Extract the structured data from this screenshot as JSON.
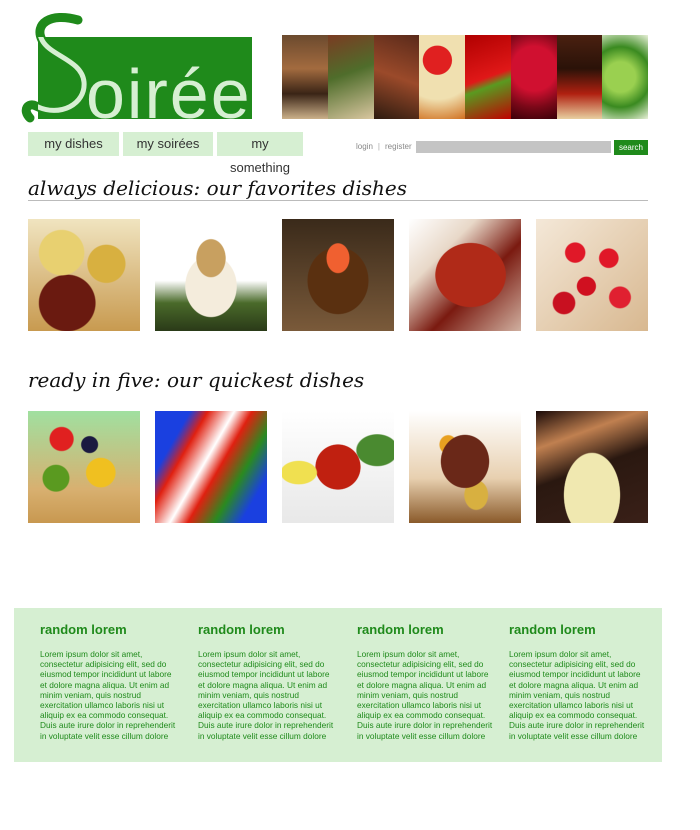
{
  "brand": {
    "name": "Soirée",
    "primary": "#1f8a1b",
    "pale": "#d6efd2"
  },
  "nav": {
    "items": [
      "my dishes",
      "my soirées",
      "my something"
    ]
  },
  "auth": {
    "login": "login",
    "separator": "|",
    "register": "register"
  },
  "search": {
    "placeholder": "",
    "button": "search"
  },
  "sections": [
    {
      "title": "always delicious: our favorites dishes"
    },
    {
      "title": "ready in five: our quickest dishes"
    }
  ],
  "footer": {
    "columns": [
      {
        "heading": "random lorem",
        "body": "Lorem ipsum dolor sit amet, consectetur adipisicing elit, sed do eiusmod tempor incididunt ut labore et dolore magna aliqua. Ut enim ad minim veniam, quis nostrud exercitation ullamco laboris nisi ut aliquip ex ea commodo consequat. Duis aute irure dolor in reprehenderit in voluptate velit esse cillum dolore"
      },
      {
        "heading": "random lorem",
        "body": "Lorem ipsum dolor sit amet, consectetur adipisicing elit, sed do eiusmod tempor incididunt ut labore et dolore magna aliqua. Ut enim ad minim veniam, quis nostrud exercitation ullamco laboris nisi ut aliquip ex ea commodo consequat. Duis aute irure dolor in reprehenderit in voluptate velit esse cillum dolore"
      },
      {
        "heading": "random lorem",
        "body": "Lorem ipsum dolor sit amet, consectetur adipisicing elit, sed do eiusmod tempor incididunt ut labore et dolore magna aliqua. Ut enim ad minim veniam, quis nostrud exercitation ullamco laboris nisi ut aliquip ex ea commodo consequat. Duis aute irure dolor in reprehenderit in voluptate velit esse cillum dolore"
      },
      {
        "heading": "random lorem",
        "body": "Lorem ipsum dolor sit amet, consectetur adipisicing elit, sed do eiusmod tempor incididunt ut labore et dolore magna aliqua. Ut enim ad minim veniam, quis nostrud exercitation ullamco laboris nisi ut aliquip ex ea commodo consequat. Duis aute irure dolor in reprehenderit in voluptate velit esse cillum dolore"
      }
    ]
  }
}
